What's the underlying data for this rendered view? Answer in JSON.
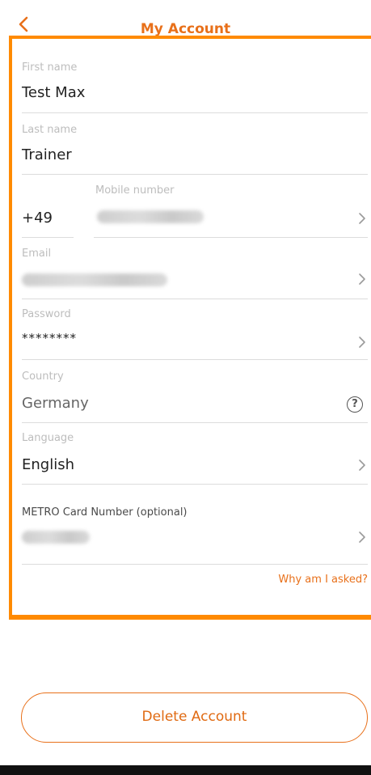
{
  "header": {
    "title": "My Account"
  },
  "fields": {
    "first_name": {
      "label": "First name",
      "value": "Test Max"
    },
    "last_name": {
      "label": "Last name",
      "value": "Trainer"
    },
    "mobile": {
      "label": "Mobile number",
      "country_code": "+49"
    },
    "email": {
      "label": "Email"
    },
    "password": {
      "label": "Password",
      "value": "********"
    },
    "country": {
      "label": "Country",
      "value": "Germany"
    },
    "language": {
      "label": "Language",
      "value": "English"
    },
    "metro_card": {
      "label": "METRO Card Number (optional)"
    }
  },
  "why_link": "Why am I asked?",
  "delete_button": "Delete Account",
  "colors": {
    "accent": "#e8701a",
    "highlight_frame": "#ff8a00"
  },
  "icons": {
    "back": "chevron-left-icon",
    "chevron": "chevron-right-icon",
    "help": "question-circle-icon"
  }
}
